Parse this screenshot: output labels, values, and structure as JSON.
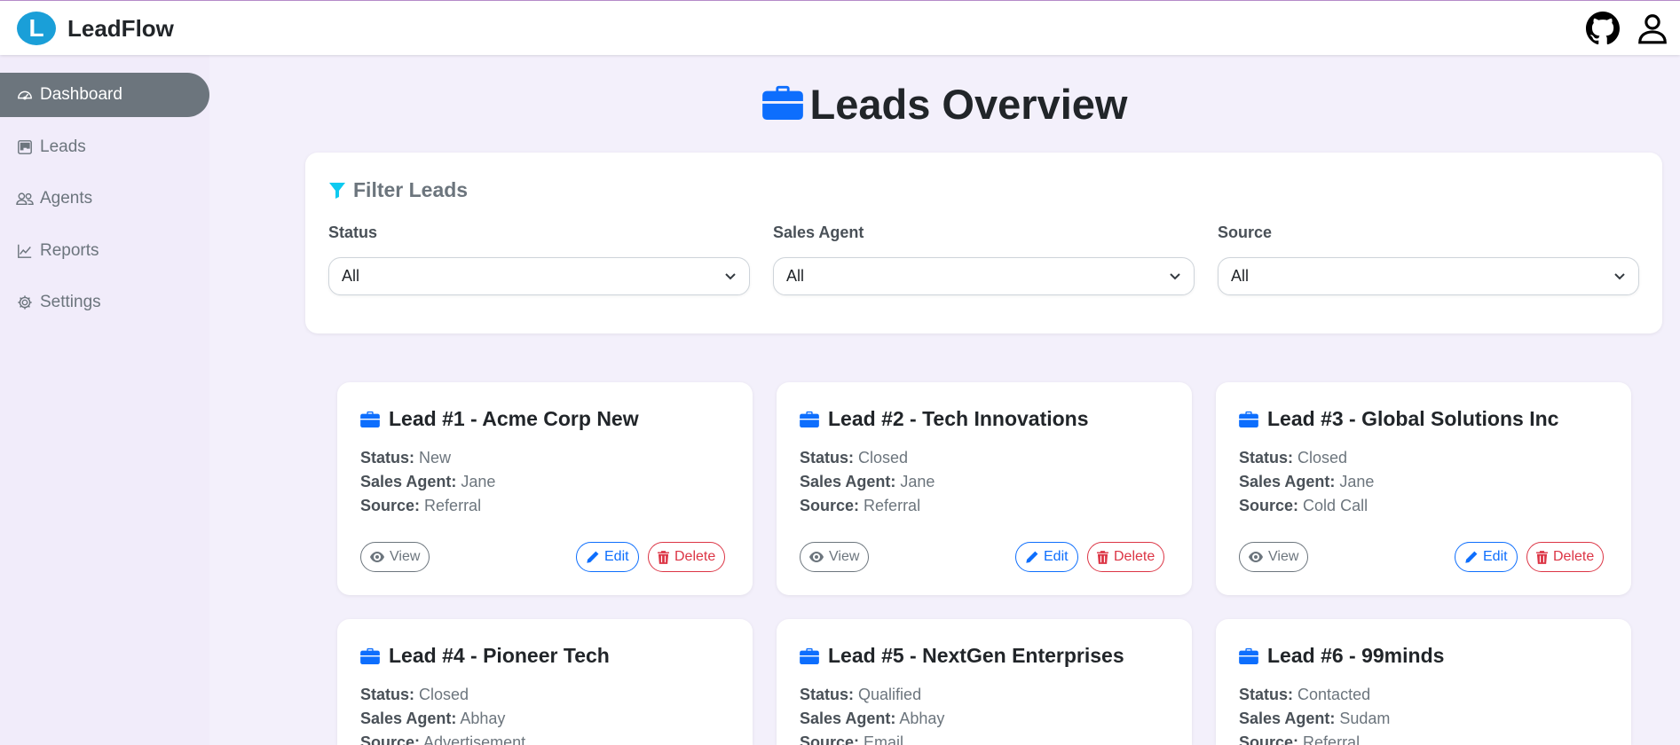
{
  "app": {
    "name": "LeadFlow",
    "logo_letter": "L"
  },
  "topbar": {
    "github_icon": "github-icon",
    "user_icon": "user-icon"
  },
  "sidebar": {
    "items": [
      {
        "label": "Dashboard",
        "icon": "speedometer-icon",
        "active": true
      },
      {
        "label": "Leads",
        "icon": "kanban-icon",
        "active": false
      },
      {
        "label": "Agents",
        "icon": "people-icon",
        "active": false
      },
      {
        "label": "Reports",
        "icon": "graph-icon",
        "active": false
      },
      {
        "label": "Settings",
        "icon": "gear-icon",
        "active": false
      }
    ]
  },
  "page": {
    "title": "Leads Overview",
    "title_icon": "briefcase-icon"
  },
  "filters": {
    "title": "Filter Leads",
    "status": {
      "label": "Status",
      "value": "All"
    },
    "agent": {
      "label": "Sales Agent",
      "value": "All"
    },
    "source": {
      "label": "Source",
      "value": "All"
    }
  },
  "labels": {
    "status": "Status:",
    "agent": "Sales Agent:",
    "source": "Source:",
    "view": "View",
    "edit": "Edit",
    "delete": "Delete"
  },
  "leads": [
    {
      "title": "Lead #1 - Acme Corp New",
      "status": "New",
      "agent": "Jane",
      "source": "Referral"
    },
    {
      "title": "Lead #2 - Tech Innovations",
      "status": "Closed",
      "agent": "Jane",
      "source": "Referral"
    },
    {
      "title": "Lead #3 - Global Solutions Inc",
      "status": "Closed",
      "agent": "Jane",
      "source": "Cold Call"
    },
    {
      "title": "Lead #4 - Pioneer Tech",
      "status": "Closed",
      "agent": "Abhay",
      "source": "Advertisement"
    },
    {
      "title": "Lead #5 - NextGen Enterprises",
      "status": "Qualified",
      "agent": "Abhay",
      "source": "Email"
    },
    {
      "title": "Lead #6 - 99minds",
      "status": "Contacted",
      "agent": "Sudam",
      "source": "Referral"
    }
  ],
  "colors": {
    "primary": "#0d6efd",
    "danger": "#dc3545",
    "secondary": "#6c757d",
    "filter_icon": "#0dcaf0",
    "sidebar_bg": "#f1ecfa",
    "logo": "#1a9fd8"
  }
}
